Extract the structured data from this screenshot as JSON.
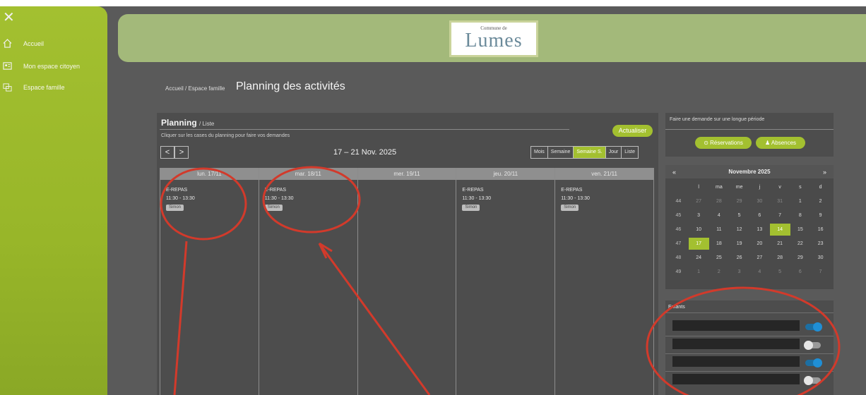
{
  "sidebar": {
    "close_icon": "close-icon",
    "items": [
      {
        "label": "Accueil",
        "icon": "home-icon"
      },
      {
        "label": "Mon espace citoyen",
        "icon": "user-card-icon"
      },
      {
        "label": "Espace famille",
        "icon": "family-icon"
      }
    ]
  },
  "header": {
    "logo_small": "Commune de",
    "logo_main": "Lumes"
  },
  "breadcrumb": "Accueil / Espace famille",
  "page_title": "Planning des activités",
  "planning": {
    "title": "Planning",
    "subtitle": "/ Liste",
    "hint": "Cliquer sur les cases du planning pour faire vos demandes",
    "update_label": "Actualiser",
    "prev": "<",
    "next": ">",
    "range": "17 – 21 Nov. 2025",
    "views": [
      "Mois",
      "Semaine",
      "Semaine S.",
      "Jour",
      "Liste"
    ],
    "days": [
      {
        "header": "lun. 17/11",
        "event": {
          "title": "E-REPAS",
          "time": "11:30 - 13:30",
          "tag": "Simon"
        }
      },
      {
        "header": "mar. 18/11",
        "event": {
          "title": "E-REPAS",
          "time": "11:30 - 13:30",
          "tag": "Simon"
        }
      },
      {
        "header": "mer. 19/11",
        "event": null
      },
      {
        "header": "jeu. 20/11",
        "event": {
          "title": "E-REPAS",
          "time": "11:30 - 13:30",
          "tag": "Simon"
        }
      },
      {
        "header": "ven. 21/11",
        "event": {
          "title": "E-REPAS",
          "time": "11:30 - 13:30",
          "tag": "Simon"
        }
      }
    ]
  },
  "request": {
    "title": "Faire une demande sur une longue période",
    "reservations_label": "Réservations",
    "absences_label": "Absences"
  },
  "calendar": {
    "prev": "«",
    "next": "»",
    "month": "Novembre 2025",
    "day_headers": [
      "l",
      "ma",
      "me",
      "j",
      "v",
      "s",
      "d"
    ],
    "weeks": [
      {
        "wk": "44",
        "days": [
          "27",
          "28",
          "29",
          "30",
          "31",
          "1",
          "2"
        ]
      },
      {
        "wk": "45",
        "days": [
          "3",
          "4",
          "5",
          "6",
          "7",
          "8",
          "9"
        ]
      },
      {
        "wk": "46",
        "days": [
          "10",
          "11",
          "12",
          "13",
          "14",
          "15",
          "16"
        ]
      },
      {
        "wk": "47",
        "days": [
          "17",
          "18",
          "19",
          "20",
          "21",
          "22",
          "23"
        ]
      },
      {
        "wk": "48",
        "days": [
          "24",
          "25",
          "26",
          "27",
          "28",
          "29",
          "30"
        ]
      },
      {
        "wk": "49",
        "days": [
          "1",
          "2",
          "3",
          "4",
          "5",
          "6",
          "7"
        ]
      }
    ],
    "highlighted": [
      "14",
      "17"
    ]
  },
  "enfants": {
    "title": "Enfants",
    "rows": [
      {
        "toggle": "on"
      },
      {
        "toggle": "off"
      },
      {
        "toggle": "on"
      },
      {
        "toggle": "off"
      }
    ]
  },
  "colors": {
    "brand_green": "#a3c030",
    "annotation_red": "#d23a2b",
    "toggle_blue": "#1f8fd6"
  }
}
